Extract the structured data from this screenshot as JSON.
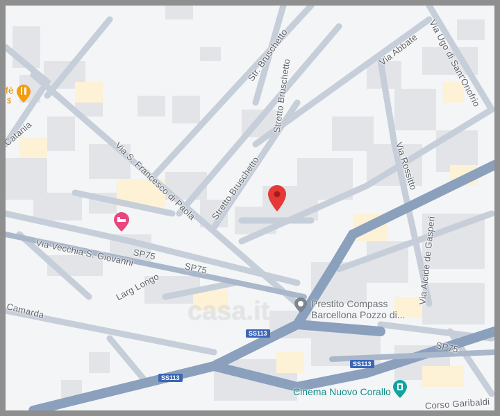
{
  "map": {
    "watermark": "casa.it",
    "streets": {
      "via_ugo": "Via Ugo di Sant'Onofrio",
      "str_bruschetto": "Str. Bruschetto",
      "stretto_bruschetto_1": "Stretto Bruschetto",
      "stretto_bruschetto_2": "Stretto Bruschetto",
      "via_abbate": "Via Abbate",
      "via_rossitto": "Via Rossitto",
      "via_sfrancesco": "Via S. Francesco di Paola",
      "catania": "Catania",
      "via_vecchia": "Via Vecchia S. Giovanni",
      "sp75_a": "SP75",
      "sp75_b": "SP75",
      "sp75_c": "SP75",
      "larg_longo": "Larg Longo",
      "camarda": "Camarda",
      "via_alcide": "Via Alcide de Gasperi",
      "garibaldi": "Corso Garibaldi"
    },
    "shields": {
      "ss113_a": "SS113",
      "ss113_b": "SS113",
      "ss113_c": "SS113"
    },
    "pois": {
      "prestito_line1": "Prestito Compass",
      "prestito_line2": "Barcellona Pozzo di...",
      "cinema": "Cinema Nuovo Corallo",
      "cafe": "fè",
      "cafe_price": "$"
    },
    "colors": {
      "background": "#f4f5f7",
      "road": "#bfc7d2",
      "major_road": "#8aa0bd",
      "block": "#e2e4e8",
      "highlight_block": "#fdf1d6",
      "pin": "#e53935",
      "hotel_pin": "#e8477e",
      "food_pin": "#f39c12",
      "cinema_icon": "#12a4a0",
      "shield": "#3c66b6"
    }
  }
}
